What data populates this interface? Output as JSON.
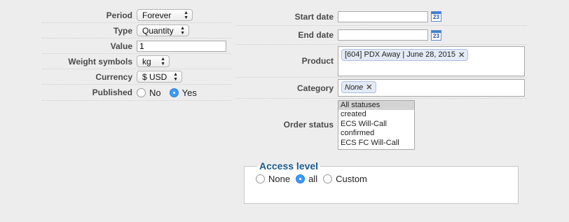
{
  "left_form": {
    "period": {
      "label": "Period",
      "value": "Forever"
    },
    "type": {
      "label": "Type",
      "value": "Quantity"
    },
    "value": {
      "label": "Value",
      "value": "1"
    },
    "weight_symbols": {
      "label": "Weight symbols",
      "value": "kg"
    },
    "currency": {
      "label": "Currency",
      "value": "$ USD"
    },
    "published": {
      "label": "Published",
      "options": [
        "No",
        "Yes"
      ],
      "selected": "Yes"
    }
  },
  "right_form": {
    "start_date": {
      "label": "Start date",
      "value": "",
      "calendar_icon_text": "23"
    },
    "end_date": {
      "label": "End date",
      "value": "",
      "calendar_icon_text": "23"
    },
    "product": {
      "label": "Product",
      "chips": [
        "[604] PDX Away | June 28, 2015"
      ]
    },
    "category": {
      "label": "Category",
      "chips": [
        "None"
      ]
    },
    "order_status": {
      "label": "Order status",
      "options": [
        "All statuses",
        "created",
        "ECS Will-Call",
        "confirmed",
        "ECS FC Will-Call"
      ],
      "selected": "All statuses"
    }
  },
  "access_level": {
    "legend": "Access level",
    "options": [
      "None",
      "all",
      "Custom"
    ],
    "selected": "all"
  },
  "colors": {
    "background": "#ededed",
    "radio_selected": "#3b99fc",
    "legend_text": "#1b5a8c",
    "chip_background": "#e4ebf7"
  }
}
